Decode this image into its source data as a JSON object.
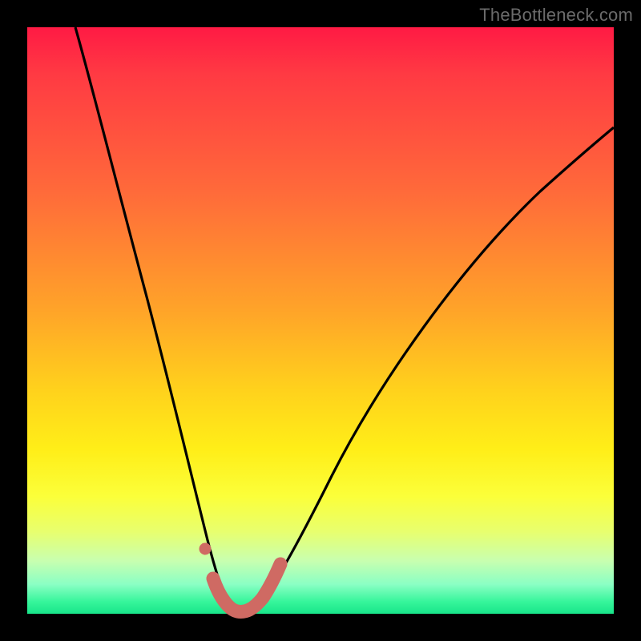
{
  "watermark": "TheBottleneck.com",
  "colors": {
    "page_bg": "#000000",
    "gradient_top": "#ff1a44",
    "gradient_mid": "#ffd21c",
    "gradient_bottom": "#18e58a",
    "curve": "#000000",
    "marker": "#cf6a63"
  },
  "chart_data": {
    "type": "line",
    "title": "",
    "xlabel": "",
    "ylabel": "",
    "xlim": [
      0,
      100
    ],
    "ylim": [
      0,
      100
    ],
    "grid": false,
    "legend": false,
    "annotations": [],
    "series": [
      {
        "name": "bottleneck-curve",
        "x": [
          8,
          10,
          12,
          15,
          18,
          21,
          24,
          26,
          28,
          30,
          31,
          32,
          33,
          34,
          35,
          36,
          37,
          38,
          40,
          44,
          50,
          58,
          68,
          80,
          92,
          100
        ],
        "y": [
          100,
          93,
          86,
          75,
          64,
          53,
          41,
          32,
          23,
          14,
          10,
          6,
          3,
          1,
          0,
          0,
          1,
          2,
          5,
          13,
          25,
          40,
          55,
          68,
          78,
          84
        ]
      }
    ],
    "markers": {
      "name": "highlight-band",
      "description": "coral dotted/rounded segment around trough",
      "x": [
        30.5,
        31.5,
        32.5,
        33.5,
        34.5,
        35.5,
        36.5,
        37.5,
        38.5,
        39.5
      ],
      "y": [
        9,
        5,
        2,
        0.5,
        0,
        0,
        0.5,
        1.5,
        3,
        5
      ],
      "color": "#cf6a63"
    }
  }
}
